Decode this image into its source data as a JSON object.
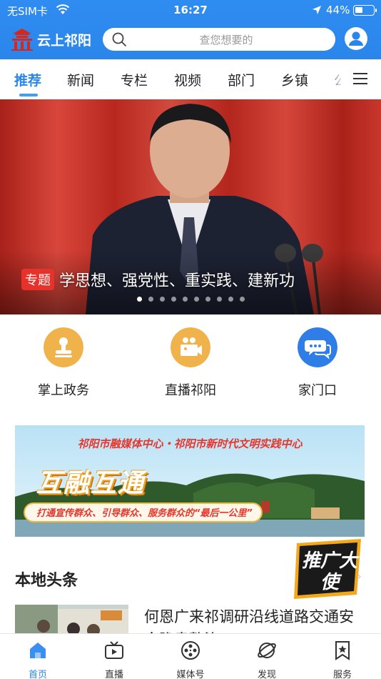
{
  "status_bar": {
    "carrier": "无SIM卡",
    "time": "16:27",
    "battery_text": "44%",
    "battery_level": 0.44
  },
  "header": {
    "app_name": "云上祁阳",
    "search_placeholder": "查您想要的"
  },
  "tabs": {
    "items": [
      "推荐",
      "新闻",
      "专栏",
      "视频",
      "部门",
      "乡镇",
      "公"
    ],
    "active": "推荐"
  },
  "hero": {
    "tag": "专题",
    "title": "学思想、强党性、重实践、建新功",
    "dot_count": 10,
    "active_dot": 0
  },
  "quick_entries": [
    {
      "label": "掌上政务",
      "icon": "stamp-icon",
      "color": "#f0b24a"
    },
    {
      "label": "直播祁阳",
      "icon": "video-camera-icon",
      "color": "#f0b24a"
    },
    {
      "label": "家门口",
      "icon": "chat-bubble-icon",
      "color": "#2f7ee8"
    }
  ],
  "promo": {
    "line1": "祁阳市融媒体中心・祁阳市新时代文明实践中心",
    "line2": "互融互通",
    "line3": "打通宣传群众、引导群众、服务群众的“最后一公里”"
  },
  "local_headlines": {
    "section_title": "本地头条",
    "badge_text": "推广大使",
    "first_item_title": "何恩广来祁调研沿线道路交通安全隐患整治"
  },
  "bottom_nav": {
    "items": [
      {
        "label": "首页",
        "icon": "home-icon"
      },
      {
        "label": "直播",
        "icon": "tv-icon"
      },
      {
        "label": "媒体号",
        "icon": "film-reel-icon"
      },
      {
        "label": "发现",
        "icon": "planet-icon"
      },
      {
        "label": "服务",
        "icon": "bookmark-star-icon"
      }
    ],
    "active": "首页"
  },
  "colors": {
    "brand_blue": "#2a86ea",
    "tag_red": "#e6322b",
    "entry_orange": "#f0b24a"
  }
}
